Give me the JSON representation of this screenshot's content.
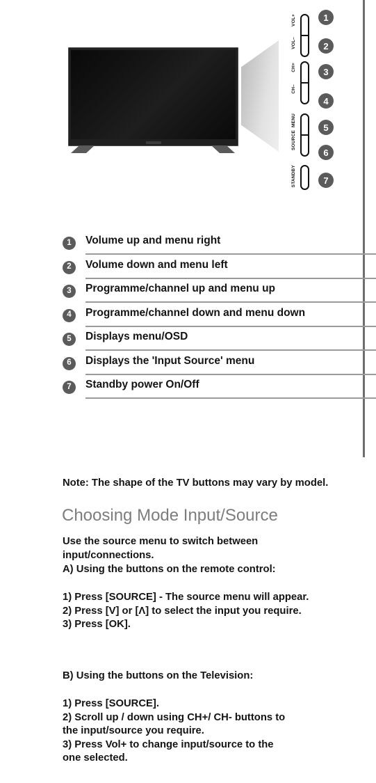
{
  "page": {
    "margin_rule_color": "#6e6e6e",
    "accent_dot_color": "#5b5b5b",
    "heading_color": "#7d7d7d",
    "rule_color": "#9a9a9a"
  },
  "diagram": {
    "tv_alt": "Front view of flat-screen television with stand",
    "wedge_alt": "Perspective side panel of television",
    "buttons": [
      {
        "number": "1",
        "label": "VOL+"
      },
      {
        "number": "2",
        "label": "VOL–"
      },
      {
        "number": "3",
        "label": "CH+"
      },
      {
        "number": "4",
        "label": "CH–"
      },
      {
        "number": "5",
        "label": "MENU"
      },
      {
        "number": "6",
        "label": "SOURCE"
      },
      {
        "number": "7",
        "label": "STANDBY"
      }
    ]
  },
  "legend": {
    "rows": [
      {
        "number": "1",
        "text": "Volume up and menu right",
        "rule_width": 465
      },
      {
        "number": "2",
        "text": "Volume down and menu left",
        "rule_width": 465
      },
      {
        "number": "3",
        "text": "Programme/channel up and menu up",
        "rule_width": 465
      },
      {
        "number": "4",
        "text": "Programme/channel down and menu down",
        "rule_width": 450
      },
      {
        "number": "5",
        "text": "Displays menu/OSD",
        "rule_width": 465
      },
      {
        "number": "6",
        "text": "Displays the 'Input Source' menu",
        "rule_width": 465
      },
      {
        "number": "7",
        "text": "Standby power On/Off",
        "rule_width": 465
      }
    ]
  },
  "content": {
    "note_label": "Note",
    "note_text": ": The shape of the TV buttons may vary by model.",
    "section_title": "Choosing Mode Input/Source",
    "intro": "Use the source menu to switch between\ninput/connections.",
    "method_a_heading": "A) Using the buttons on the remote control:",
    "method_a_steps": "1) Press [SOURCE] - The source menu will appear.\n2) Press [V] or [Λ] to select the input you require.\n3) Press [OK].",
    "method_b_heading": "B) Using the buttons on the Television:",
    "method_b_steps": "1) Press [SOURCE].\n2) Scroll up / down using CH+/ CH- buttons to\nthe input/source you require.\n3) Press Vol+ to change input/source to the\none selected."
  }
}
